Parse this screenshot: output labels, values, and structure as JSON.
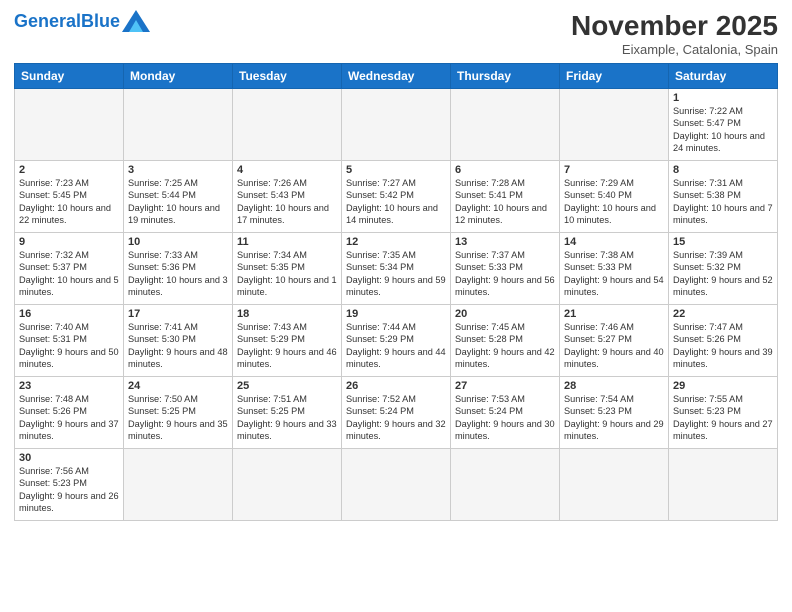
{
  "header": {
    "logo_general": "General",
    "logo_blue": "Blue",
    "month_title": "November 2025",
    "location": "Eixample, Catalonia, Spain"
  },
  "days_of_week": [
    "Sunday",
    "Monday",
    "Tuesday",
    "Wednesday",
    "Thursday",
    "Friday",
    "Saturday"
  ],
  "weeks": [
    [
      {
        "day": "",
        "info": ""
      },
      {
        "day": "",
        "info": ""
      },
      {
        "day": "",
        "info": ""
      },
      {
        "day": "",
        "info": ""
      },
      {
        "day": "",
        "info": ""
      },
      {
        "day": "",
        "info": ""
      },
      {
        "day": "1",
        "info": "Sunrise: 7:22 AM\nSunset: 5:47 PM\nDaylight: 10 hours and 24 minutes."
      }
    ],
    [
      {
        "day": "2",
        "info": "Sunrise: 7:23 AM\nSunset: 5:45 PM\nDaylight: 10 hours and 22 minutes."
      },
      {
        "day": "3",
        "info": "Sunrise: 7:25 AM\nSunset: 5:44 PM\nDaylight: 10 hours and 19 minutes."
      },
      {
        "day": "4",
        "info": "Sunrise: 7:26 AM\nSunset: 5:43 PM\nDaylight: 10 hours and 17 minutes."
      },
      {
        "day": "5",
        "info": "Sunrise: 7:27 AM\nSunset: 5:42 PM\nDaylight: 10 hours and 14 minutes."
      },
      {
        "day": "6",
        "info": "Sunrise: 7:28 AM\nSunset: 5:41 PM\nDaylight: 10 hours and 12 minutes."
      },
      {
        "day": "7",
        "info": "Sunrise: 7:29 AM\nSunset: 5:40 PM\nDaylight: 10 hours and 10 minutes."
      },
      {
        "day": "8",
        "info": "Sunrise: 7:31 AM\nSunset: 5:38 PM\nDaylight: 10 hours and 7 minutes."
      }
    ],
    [
      {
        "day": "9",
        "info": "Sunrise: 7:32 AM\nSunset: 5:37 PM\nDaylight: 10 hours and 5 minutes."
      },
      {
        "day": "10",
        "info": "Sunrise: 7:33 AM\nSunset: 5:36 PM\nDaylight: 10 hours and 3 minutes."
      },
      {
        "day": "11",
        "info": "Sunrise: 7:34 AM\nSunset: 5:35 PM\nDaylight: 10 hours and 1 minute."
      },
      {
        "day": "12",
        "info": "Sunrise: 7:35 AM\nSunset: 5:34 PM\nDaylight: 9 hours and 59 minutes."
      },
      {
        "day": "13",
        "info": "Sunrise: 7:37 AM\nSunset: 5:33 PM\nDaylight: 9 hours and 56 minutes."
      },
      {
        "day": "14",
        "info": "Sunrise: 7:38 AM\nSunset: 5:33 PM\nDaylight: 9 hours and 54 minutes."
      },
      {
        "day": "15",
        "info": "Sunrise: 7:39 AM\nSunset: 5:32 PM\nDaylight: 9 hours and 52 minutes."
      }
    ],
    [
      {
        "day": "16",
        "info": "Sunrise: 7:40 AM\nSunset: 5:31 PM\nDaylight: 9 hours and 50 minutes."
      },
      {
        "day": "17",
        "info": "Sunrise: 7:41 AM\nSunset: 5:30 PM\nDaylight: 9 hours and 48 minutes."
      },
      {
        "day": "18",
        "info": "Sunrise: 7:43 AM\nSunset: 5:29 PM\nDaylight: 9 hours and 46 minutes."
      },
      {
        "day": "19",
        "info": "Sunrise: 7:44 AM\nSunset: 5:29 PM\nDaylight: 9 hours and 44 minutes."
      },
      {
        "day": "20",
        "info": "Sunrise: 7:45 AM\nSunset: 5:28 PM\nDaylight: 9 hours and 42 minutes."
      },
      {
        "day": "21",
        "info": "Sunrise: 7:46 AM\nSunset: 5:27 PM\nDaylight: 9 hours and 40 minutes."
      },
      {
        "day": "22",
        "info": "Sunrise: 7:47 AM\nSunset: 5:26 PM\nDaylight: 9 hours and 39 minutes."
      }
    ],
    [
      {
        "day": "23",
        "info": "Sunrise: 7:48 AM\nSunset: 5:26 PM\nDaylight: 9 hours and 37 minutes."
      },
      {
        "day": "24",
        "info": "Sunrise: 7:50 AM\nSunset: 5:25 PM\nDaylight: 9 hours and 35 minutes."
      },
      {
        "day": "25",
        "info": "Sunrise: 7:51 AM\nSunset: 5:25 PM\nDaylight: 9 hours and 33 minutes."
      },
      {
        "day": "26",
        "info": "Sunrise: 7:52 AM\nSunset: 5:24 PM\nDaylight: 9 hours and 32 minutes."
      },
      {
        "day": "27",
        "info": "Sunrise: 7:53 AM\nSunset: 5:24 PM\nDaylight: 9 hours and 30 minutes."
      },
      {
        "day": "28",
        "info": "Sunrise: 7:54 AM\nSunset: 5:23 PM\nDaylight: 9 hours and 29 minutes."
      },
      {
        "day": "29",
        "info": "Sunrise: 7:55 AM\nSunset: 5:23 PM\nDaylight: 9 hours and 27 minutes."
      }
    ],
    [
      {
        "day": "30",
        "info": "Sunrise: 7:56 AM\nSunset: 5:23 PM\nDaylight: 9 hours and 26 minutes."
      },
      {
        "day": "",
        "info": ""
      },
      {
        "day": "",
        "info": ""
      },
      {
        "day": "",
        "info": ""
      },
      {
        "day": "",
        "info": ""
      },
      {
        "day": "",
        "info": ""
      },
      {
        "day": "",
        "info": ""
      }
    ]
  ]
}
